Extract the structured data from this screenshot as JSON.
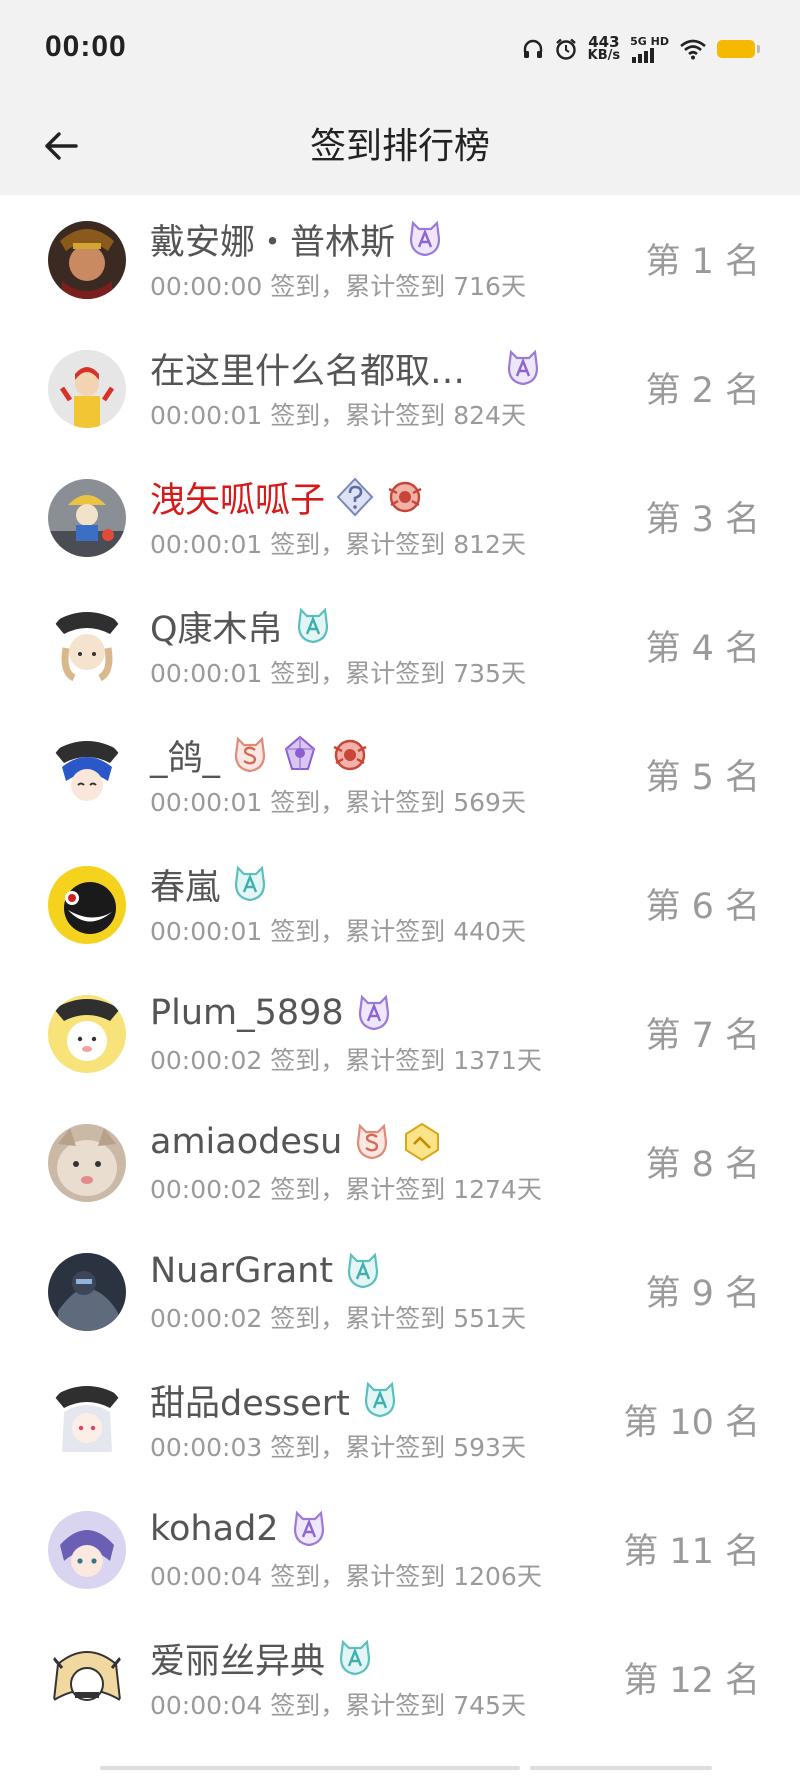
{
  "status": {
    "time": "00:00",
    "net_speed_value": "443",
    "net_speed_unit": "KB/s",
    "signal_label": "5G HD",
    "icons": [
      "headphones-icon",
      "alarm-icon",
      "signal-icon",
      "wifi-icon",
      "battery-icon"
    ],
    "battery_color": "#f6b800"
  },
  "header": {
    "title": "签到排行榜",
    "back_icon": "arrow-left-icon"
  },
  "rows": [
    {
      "name": "戴安娜・普林斯",
      "name_color": "default",
      "time": "00:00:00",
      "days": "716",
      "rank": "第 1 名",
      "badges": [
        "purple-cat-badge"
      ]
    },
    {
      "name": "在这里什么名都取…",
      "name_color": "default",
      "time": "00:00:01",
      "days": "824",
      "rank": "第 2 名",
      "badges": [
        "purple-cat-badge"
      ]
    },
    {
      "name": "洩矢呱呱子",
      "name_color": "#d61a1a",
      "time": "00:00:01",
      "days": "812",
      "rank": "第 3 名",
      "badges": [
        "diamond-question-badge",
        "red-medal-badge"
      ]
    },
    {
      "name": "Q康木帛",
      "name_color": "default",
      "time": "00:00:01",
      "days": "735",
      "rank": "第 4 名",
      "badges": [
        "teal-cat-badge"
      ]
    },
    {
      "name": "_鸽_",
      "name_color": "default",
      "time": "00:00:01",
      "days": "569",
      "rank": "第 5 名",
      "badges": [
        "pink-s-badge",
        "purple-crystal-badge",
        "red-medal-badge"
      ]
    },
    {
      "name": "春嵐",
      "name_color": "default",
      "time": "00:00:01",
      "days": "440",
      "rank": "第 6 名",
      "badges": [
        "teal-cat-badge"
      ]
    },
    {
      "name": "Plum_5898",
      "name_color": "default",
      "time": "00:00:02",
      "days": "1371",
      "rank": "第 7 名",
      "badges": [
        "purple-cat-badge"
      ]
    },
    {
      "name": "amiaodesu",
      "name_color": "default",
      "time": "00:00:02",
      "days": "1274",
      "rank": "第 8 名",
      "badges": [
        "pink-s-badge",
        "gold-hex-badge"
      ]
    },
    {
      "name": "NuarGrant",
      "name_color": "default",
      "time": "00:00:02",
      "days": "551",
      "rank": "第 9 名",
      "badges": [
        "teal-cat-badge"
      ]
    },
    {
      "name": "甜品dessert",
      "name_color": "default",
      "time": "00:00:03",
      "days": "593",
      "rank": "第 10 名",
      "badges": [
        "teal-cat-badge"
      ]
    },
    {
      "name": "kohad2",
      "name_color": "default",
      "time": "00:00:04",
      "days": "1206",
      "rank": "第 11 名",
      "badges": [
        "purple-cat-badge"
      ]
    },
    {
      "name": "爱丽丝异典",
      "name_color": "default",
      "time": "00:00:04",
      "days": "745",
      "rank": "第 12 名",
      "badges": [
        "teal-cat-badge"
      ]
    }
  ],
  "labels": {
    "checkin": "签到",
    "total_prefix": "，累计签到",
    "days_suffix": "天"
  }
}
